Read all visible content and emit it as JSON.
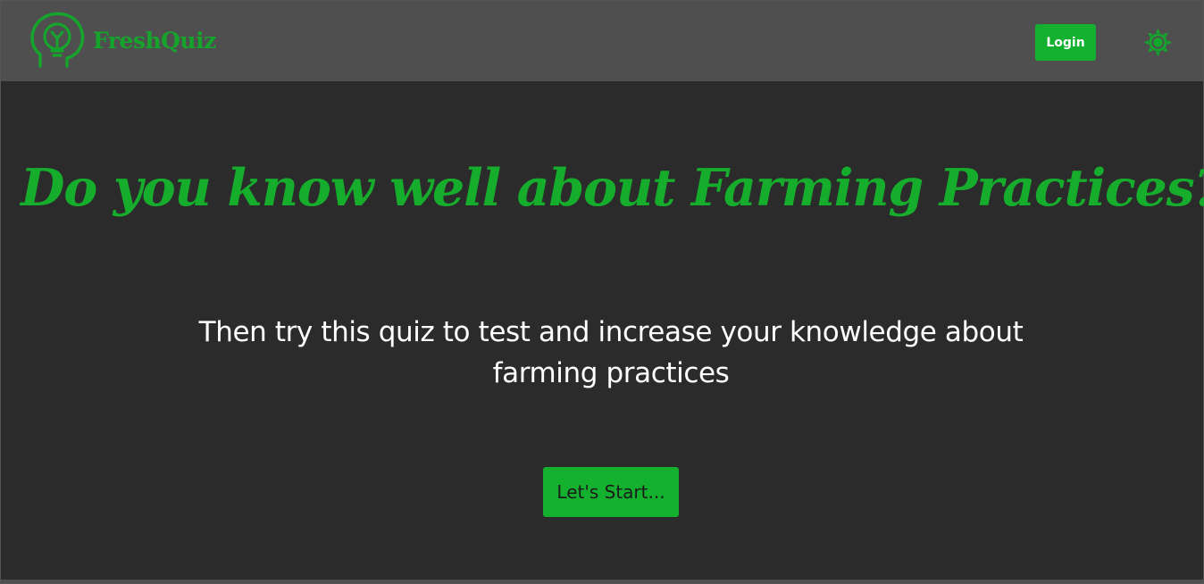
{
  "header": {
    "brand_name": "FreshQuiz",
    "logo_icon": "head-lightbulb-icon",
    "login_label": "Login",
    "theme_icon": "sun-icon"
  },
  "hero": {
    "title": "Do you know well about Farming Practices?",
    "subtitle_line1": "Then try this quiz to test and increase your knowledge about",
    "subtitle_line2": "farming practices",
    "start_label": "Let's Start..."
  },
  "colors": {
    "accent": "#13b12f",
    "title": "#16ad2c",
    "navbar": "#4f4f4f",
    "background": "#2b2b2b",
    "text": "#ffffff"
  }
}
